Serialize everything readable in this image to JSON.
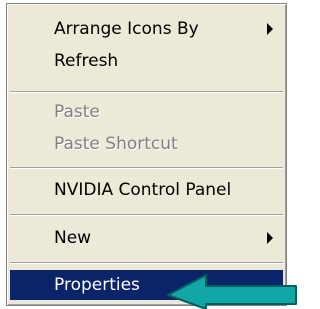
{
  "context_menu": {
    "items": [
      {
        "label": "Arrange Icons By",
        "enabled": true,
        "submenu": true
      },
      {
        "label": "Refresh",
        "enabled": true,
        "submenu": false
      },
      {
        "label": "Paste",
        "enabled": false,
        "submenu": false
      },
      {
        "label": "Paste Shortcut",
        "enabled": false,
        "submenu": false
      },
      {
        "label": "NVIDIA Control Panel",
        "enabled": true,
        "submenu": false
      },
      {
        "label": "New",
        "enabled": true,
        "submenu": true
      },
      {
        "label": "Properties",
        "enabled": true,
        "submenu": false,
        "highlighted": true
      }
    ],
    "colors": {
      "menu_background": "#ece9d8",
      "highlight_background": "#0a246a",
      "highlight_text": "#ffffff",
      "disabled_text": "#808080",
      "pointer_arrow_fill": "#12a7a7"
    }
  },
  "annotation": {
    "icon": "left-pointing-arrow-icon",
    "target": "Properties"
  }
}
